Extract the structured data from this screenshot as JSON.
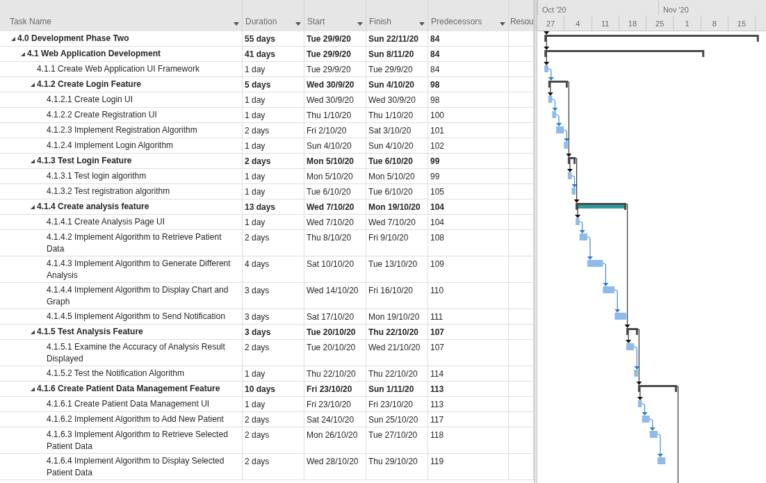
{
  "columns": [
    {
      "label": "Task Name",
      "dropdown": true
    },
    {
      "label": "Duration",
      "dropdown": true
    },
    {
      "label": "Start",
      "dropdown": true
    },
    {
      "label": "Finish",
      "dropdown": true
    },
    {
      "label": "Predecessors",
      "dropdown": true
    },
    {
      "label": "Resou",
      "dropdown": false
    }
  ],
  "timescale": {
    "months": [
      "Oct '20",
      "Nov '20"
    ],
    "weeks": [
      "27",
      "4",
      "11",
      "18",
      "25",
      "1",
      "8",
      "15"
    ]
  },
  "tasks": [
    {
      "kind": "summary",
      "expanded": true,
      "highlighted": false,
      "name": "4.0 Development Phase Two",
      "duration": "55 days",
      "start": "Tue 29/9/20",
      "finish": "Sun 22/11/20",
      "predecessors": "84",
      "children": [
        {
          "kind": "summary",
          "expanded": true,
          "highlighted": false,
          "name": "4.1 Web Application Development",
          "duration": "41 days",
          "start": "Tue 29/9/20",
          "finish": "Sun 8/11/20",
          "predecessors": "84",
          "children": [
            {
              "kind": "task",
              "name": "4.1.1 Create Web Application UI Framework",
              "duration": "1 day",
              "start": "Tue 29/9/20",
              "finish": "Tue 29/9/20",
              "predecessors": "84"
            },
            {
              "kind": "summary",
              "expanded": true,
              "highlighted": false,
              "name": "4.1.2 Create Login Feature",
              "duration": "5 days",
              "start": "Wed 30/9/20",
              "finish": "Sun 4/10/20",
              "predecessors": "98",
              "children": [
                {
                  "kind": "task",
                  "name": "4.1.2.1 Create Login UI",
                  "duration": "1 day",
                  "start": "Wed 30/9/20",
                  "finish": "Wed 30/9/20",
                  "predecessors": "98"
                },
                {
                  "kind": "task",
                  "name": "4.1.2.2 Create Registration UI",
                  "duration": "1 day",
                  "start": "Thu 1/10/20",
                  "finish": "Thu 1/10/20",
                  "predecessors": "100"
                },
                {
                  "kind": "task",
                  "name": "4.1.2.3 Implement Registration Algorithm",
                  "duration": "2 days",
                  "start": "Fri 2/10/20",
                  "finish": "Sat 3/10/20",
                  "predecessors": "101"
                },
                {
                  "kind": "task",
                  "name": "4.1.2.4 Implement Login Algorithm",
                  "duration": "1 day",
                  "start": "Sun 4/10/20",
                  "finish": "Sun 4/10/20",
                  "predecessors": "102"
                }
              ]
            },
            {
              "kind": "summary",
              "expanded": true,
              "highlighted": false,
              "name": "4.1.3 Test Login Feature",
              "duration": "2 days",
              "start": "Mon 5/10/20",
              "finish": "Tue 6/10/20",
              "predecessors": "99",
              "children": [
                {
                  "kind": "task",
                  "name": "4.1.3.1 Test login algorithm",
                  "duration": "1 day",
                  "start": "Mon 5/10/20",
                  "finish": "Mon 5/10/20",
                  "predecessors": "99"
                },
                {
                  "kind": "task",
                  "name": "4.1.3.2 Test registration algorithm",
                  "duration": "1 day",
                  "start": "Tue 6/10/20",
                  "finish": "Tue 6/10/20",
                  "predecessors": "105"
                }
              ]
            },
            {
              "kind": "summary",
              "expanded": true,
              "highlighted": true,
              "name": "4.1.4 Create analysis feature",
              "duration": "13 days",
              "start": "Wed 7/10/20",
              "finish": "Mon 19/10/20",
              "predecessors": "104",
              "children": [
                {
                  "kind": "task",
                  "name": "4.1.4.1 Create Analysis Page UI",
                  "duration": "1 day",
                  "start": "Wed 7/10/20",
                  "finish": "Wed 7/10/20",
                  "predecessors": "104"
                },
                {
                  "kind": "task",
                  "name": "4.1.4.2 Implement Algorithm to Retrieve Patient Data",
                  "duration": "2 days",
                  "start": "Thu 8/10/20",
                  "finish": "Fri 9/10/20",
                  "predecessors": "108"
                },
                {
                  "kind": "task",
                  "name": "4.1.4.3 Implement Algorithm to Generate Different Analysis",
                  "duration": "4 days",
                  "start": "Sat 10/10/20",
                  "finish": "Tue 13/10/20",
                  "predecessors": "109"
                },
                {
                  "kind": "task",
                  "name": "4.1.4.4 Implement Algorithm to Display Chart and Graph",
                  "duration": "3 days",
                  "start": "Wed 14/10/20",
                  "finish": "Fri 16/10/20",
                  "predecessors": "110"
                },
                {
                  "kind": "task",
                  "name": "4.1.4.5 Implement Algorithm to Send Notification",
                  "duration": "3 days",
                  "start": "Sat 17/10/20",
                  "finish": "Mon 19/10/20",
                  "predecessors": "111"
                }
              ]
            },
            {
              "kind": "summary",
              "expanded": true,
              "highlighted": false,
              "name": "4.1.5 Test Analysis Feature",
              "duration": "3 days",
              "start": "Tue 20/10/20",
              "finish": "Thu 22/10/20",
              "predecessors": "107",
              "children": [
                {
                  "kind": "task",
                  "name": "4.1.5.1 Examine the Accuracy of Analysis Result Displayed",
                  "duration": "2 days",
                  "start": "Tue 20/10/20",
                  "finish": "Wed 21/10/20",
                  "predecessors": "107"
                },
                {
                  "kind": "task",
                  "name": "4.1.5.2 Test the Notification Algorithm",
                  "duration": "1 day",
                  "start": "Thu 22/10/20",
                  "finish": "Thu 22/10/20",
                  "predecessors": "114"
                }
              ]
            },
            {
              "kind": "summary",
              "expanded": true,
              "highlighted": false,
              "name": "4.1.6 Create Patient Data Management Feature",
              "duration": "10 days",
              "start": "Fri 23/10/20",
              "finish": "Sun 1/11/20",
              "predecessors": "113",
              "children": [
                {
                  "kind": "task",
                  "name": "4.1.6.1 Create Patient Data Management UI",
                  "duration": "1 day",
                  "start": "Fri 23/10/20",
                  "finish": "Fri 23/10/20",
                  "predecessors": "113"
                },
                {
                  "kind": "task",
                  "name": "4.1.6.2 Implement Algorithm to Add New Patient",
                  "duration": "2 days",
                  "start": "Sat 24/10/20",
                  "finish": "Sun 25/10/20",
                  "predecessors": "117"
                },
                {
                  "kind": "task",
                  "name": "4.1.6.3 Implement Algorithm to Retrieve Selected Patient Data",
                  "duration": "2 days",
                  "start": "Mon 26/10/20",
                  "finish": "Tue 27/10/20",
                  "predecessors": "118"
                },
                {
                  "kind": "task",
                  "name": "4.1.6.4 Implement Algorithm to Display Selected Patient Data",
                  "duration": "2 days",
                  "start": "Wed 28/10/20",
                  "finish": "Thu 29/10/20",
                  "predecessors": "119"
                }
              ]
            }
          ]
        }
      ]
    }
  ]
}
